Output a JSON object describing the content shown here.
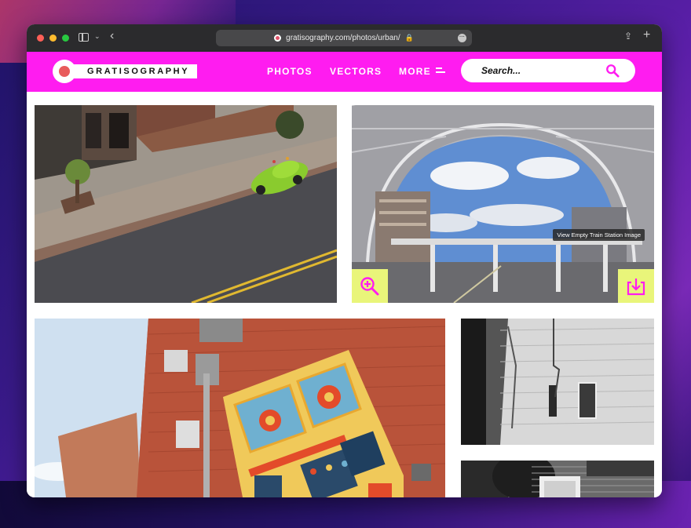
{
  "browser": {
    "url": "gratisography.com/photos/urban/",
    "icons": [
      "sidebar-icon",
      "chevron-down-icon",
      "back-icon",
      "lock-icon",
      "more-icon",
      "share-icon",
      "new-tab-icon"
    ]
  },
  "site": {
    "logo_text": "GRATISOGRAPHY",
    "nav": [
      {
        "label": "PHOTOS"
      },
      {
        "label": "VECTORS"
      },
      {
        "label": "MORE"
      }
    ],
    "search": {
      "placeholder": "Search..."
    },
    "colors": {
      "header": "#ff1cf0",
      "action_button": "#e9f57a",
      "logo_dot": "#e85b5b"
    }
  },
  "photos": [
    {
      "subject": "green car with plants on a street corner"
    },
    {
      "subject": "empty train station",
      "tooltip": "View Empty Train Station Image"
    },
    {
      "subject": "retro robot mural on brick wall"
    },
    {
      "subject": "white painted brick building"
    },
    {
      "subject": "building with window"
    }
  ]
}
